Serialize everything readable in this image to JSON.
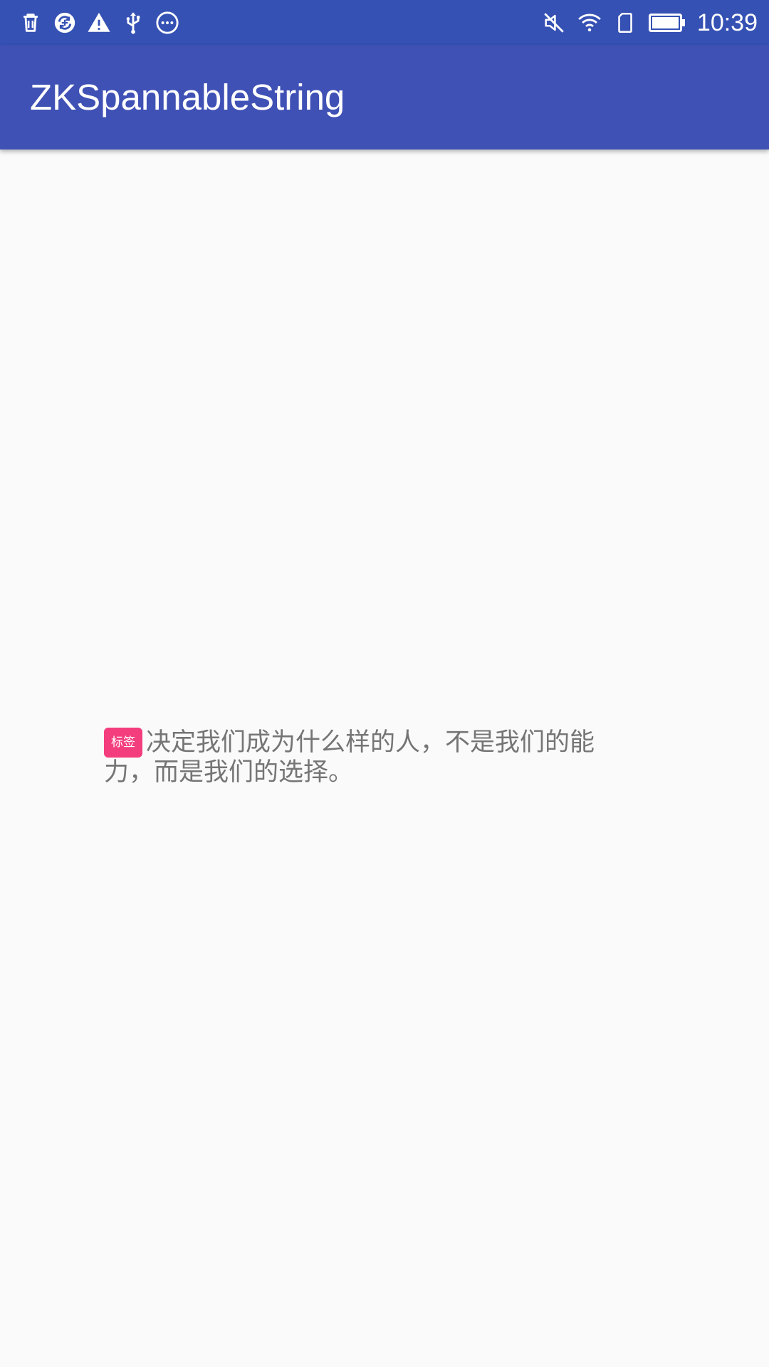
{
  "status_bar": {
    "left_icons": [
      "trash-icon",
      "sync-icon",
      "warning-icon",
      "usb-icon",
      "more-dots-icon"
    ],
    "right_icons": [
      "mute-icon",
      "wifi-icon",
      "sim-icon",
      "battery-icon"
    ],
    "time": "10:39",
    "background": "#3551b4"
  },
  "app_bar": {
    "title": "ZKSpannableString",
    "background": "#3f51b5"
  },
  "content": {
    "tag_label": "标签",
    "tag_color": "#f33d7d",
    "text": "决定我们成为什么样的人，不是我们的能力，而是我们的选择。",
    "text_color": "#757575"
  }
}
